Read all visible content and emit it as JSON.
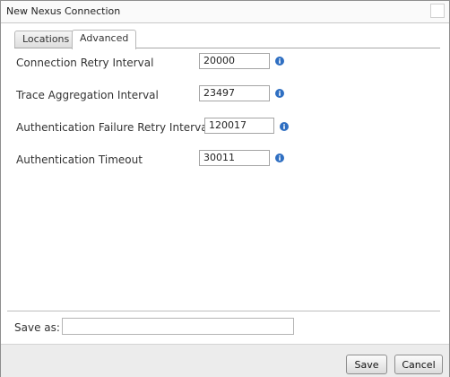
{
  "window": {
    "title": "New Nexus Connection"
  },
  "tabs": [
    {
      "label": "Locations"
    },
    {
      "label": "Advanced"
    }
  ],
  "fields": [
    {
      "label": "Connection Retry Interval",
      "value": "20000"
    },
    {
      "label": "Trace Aggregation Interval",
      "value": "23497"
    },
    {
      "label": "Authentication Failure Retry Interval",
      "value": "120017"
    },
    {
      "label": "Authentication Timeout",
      "value": "30011"
    }
  ],
  "save_as": {
    "label": "Save as:",
    "value": ""
  },
  "buttons": {
    "save": "Save",
    "cancel": "Cancel"
  },
  "colors": {
    "info_icon": "#2f6fc2"
  }
}
